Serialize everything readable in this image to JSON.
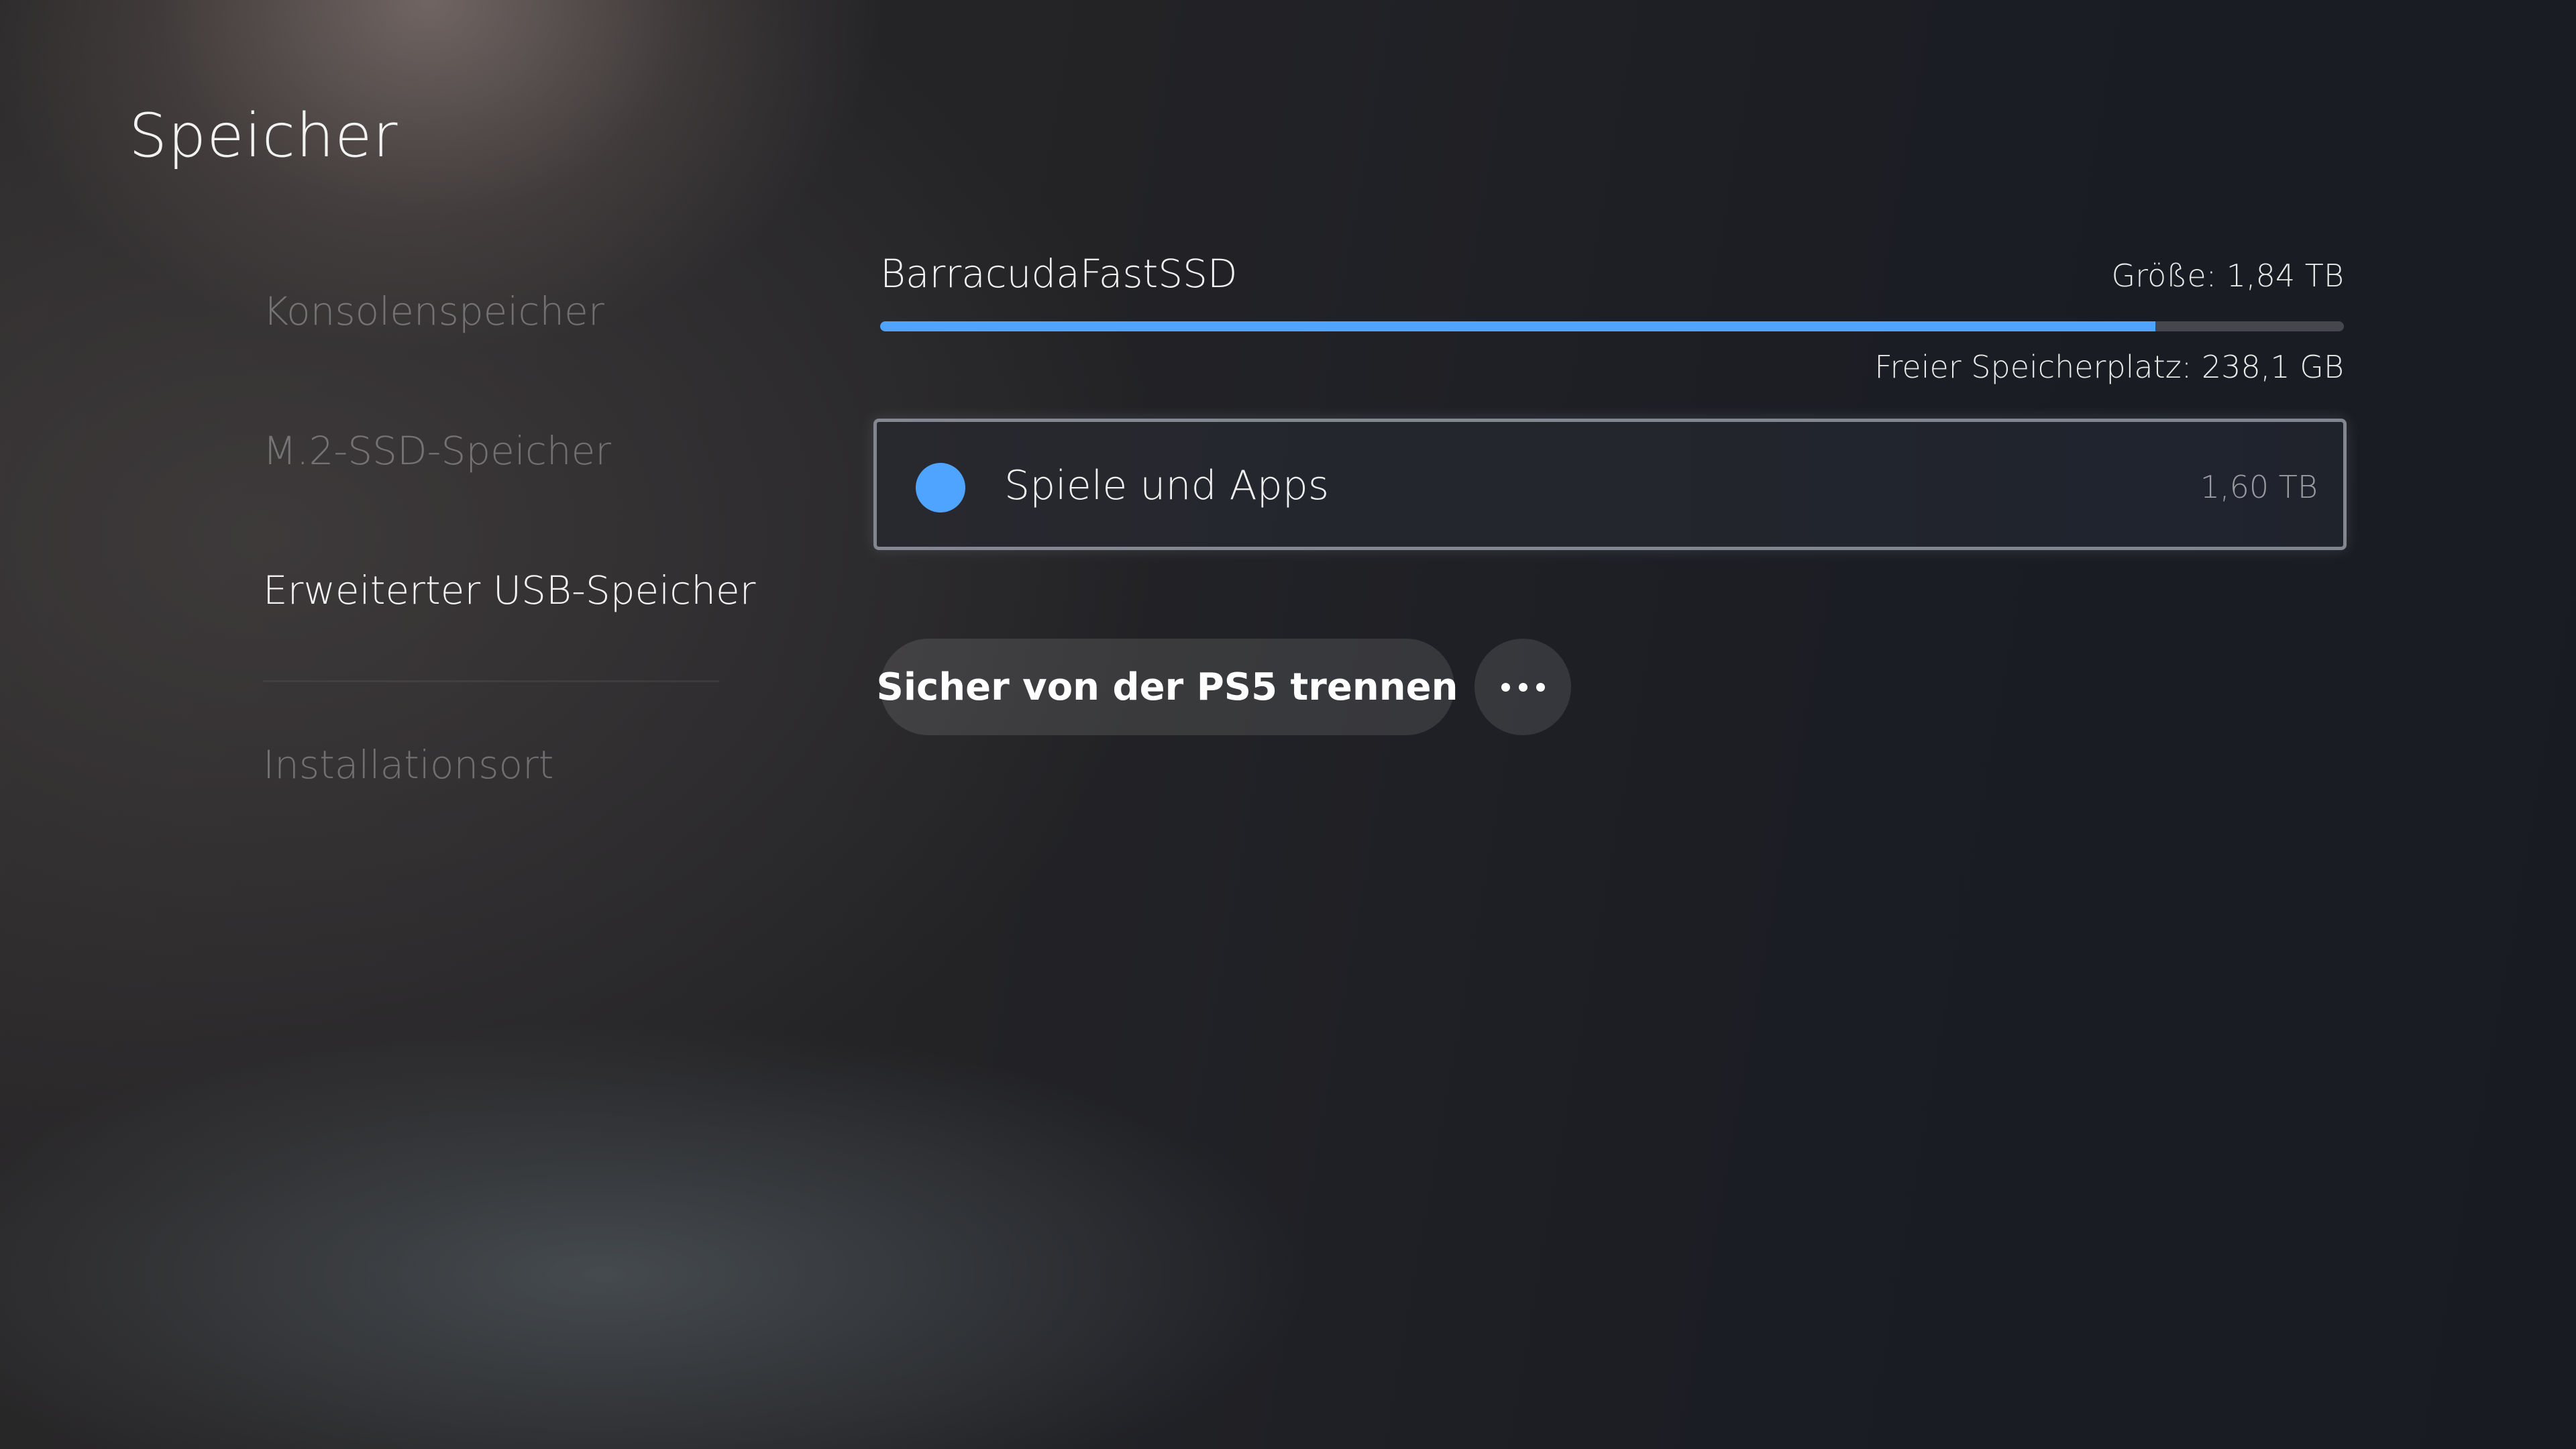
{
  "header": {
    "title": "Speicher"
  },
  "sidebar": {
    "items": [
      {
        "label": "Konsolenspeicher",
        "state": "dim"
      },
      {
        "label": "M.2-SSD-Speicher",
        "state": "dim"
      },
      {
        "label": "Erweiterter USB-Speicher",
        "state": "selected"
      },
      {
        "label": "Installationsort",
        "state": "dim"
      }
    ]
  },
  "drive": {
    "name": "BarracudaFastSSD",
    "size_label": "Größe: 1,84 TB",
    "free_label": "Freier Speicherplatz: 238,1 GB",
    "used_fraction": 0.871,
    "bar_color": "#4ea4ff"
  },
  "categories": [
    {
      "label": "Spiele und Apps",
      "value": "1,60 TB",
      "color": "#4ea4ff"
    }
  ],
  "actions": {
    "disconnect_label": "Sicher von der PS5 trennen",
    "more_icon": "more-options-icon"
  }
}
